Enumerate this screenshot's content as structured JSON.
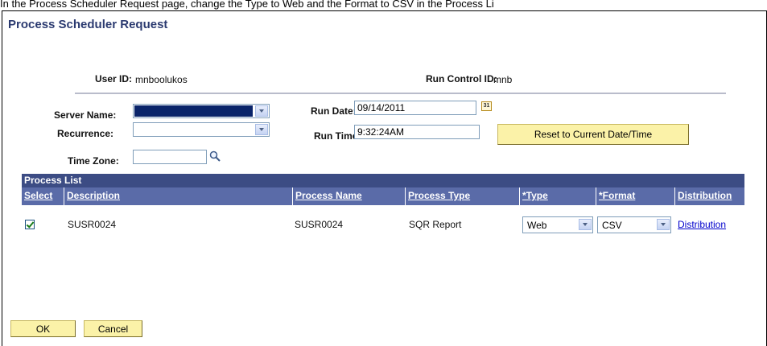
{
  "instruction": "In the Process Scheduler Request page, change the Type to Web and the Format to CSV in the Process Li",
  "page": {
    "title": "Process Scheduler Request"
  },
  "header": {
    "user_id_label": "User ID:",
    "user_id_value": "mnboolukos",
    "run_control_label": "Run Control ID:",
    "run_control_value": "mnb"
  },
  "form": {
    "server_name_label": "Server Name:",
    "server_name_value": "",
    "recurrence_label": "Recurrence:",
    "recurrence_value": "",
    "time_zone_label": "Time Zone:",
    "time_zone_value": "",
    "run_date_label": "Run Date:",
    "run_date_value": "09/14/2011",
    "run_time_label": "Run Time:",
    "run_time_value": "9:32:24AM",
    "reset_button": "Reset to Current Date/Time",
    "calendar_icon_text": "31"
  },
  "process_list": {
    "title": "Process List",
    "columns": [
      "Select",
      "Description",
      "Process Name",
      "Process Type",
      "*Type",
      "*Format",
      "Distribution"
    ],
    "rows": [
      {
        "selected": true,
        "description": "SUSR0024",
        "process_name": "SUSR0024",
        "process_type": "SQR Report",
        "type": "Web",
        "format": "CSV",
        "distribution": "Distribution"
      }
    ]
  },
  "footer": {
    "ok_label": "OK",
    "cancel_label": "Cancel"
  },
  "colors": {
    "title": "#2b3a70",
    "grid_header": "#3c4c84",
    "column_header": "#5a6ba8",
    "button": "#fbf2a8",
    "link": "#0000cc"
  },
  "icons": {
    "calendar": "calendar-icon",
    "lookup": "magnifier-icon",
    "checkbox": "checkmark-icon"
  }
}
